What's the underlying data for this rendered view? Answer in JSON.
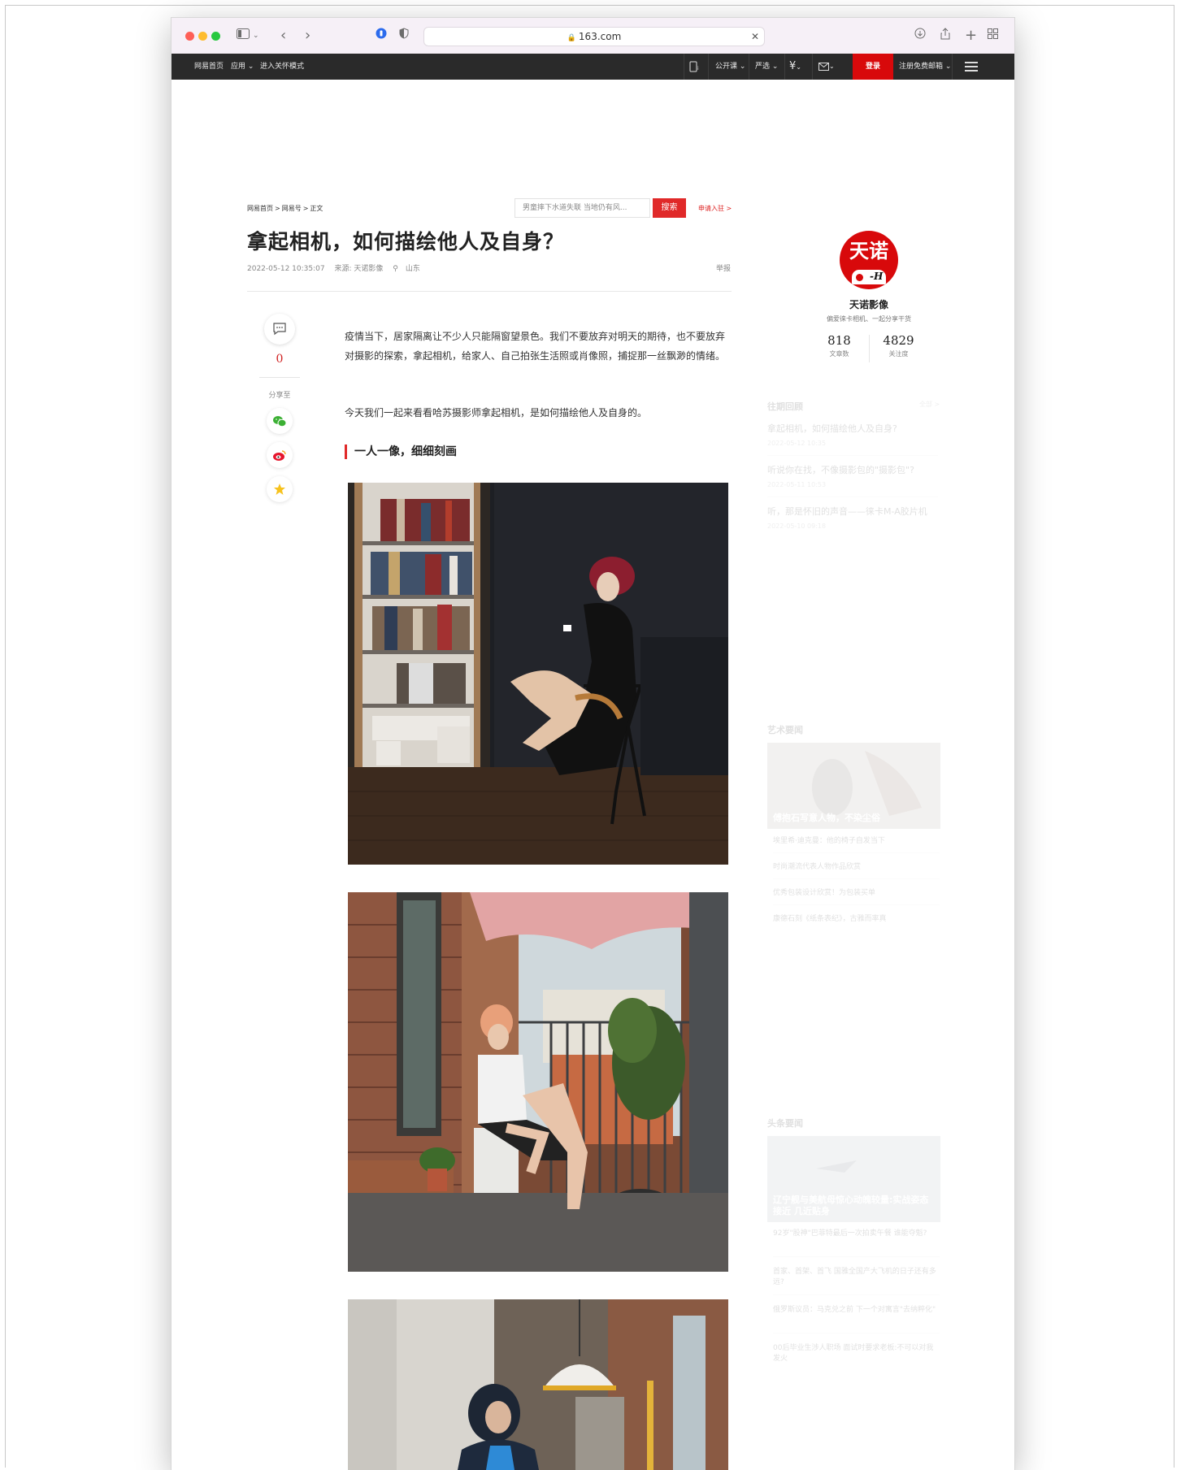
{
  "browser": {
    "url": "163.com"
  },
  "nav": {
    "home": "网易首页",
    "apps": "应用",
    "care_mode": "进入关怀模式",
    "open_course": "公开课",
    "yanxuan": "严选",
    "login": "登录",
    "free_mail": "注册免费邮箱"
  },
  "breadcrumb": {
    "home": "网易首页",
    "sep1": ">",
    "section": "网易号",
    "sep2": ">",
    "current": "正文"
  },
  "search": {
    "placeholder": "男童摔下水道失联 当地仍有风...",
    "button": "搜索",
    "apply": "申请入驻 >"
  },
  "article": {
    "title": "拿起相机，如何描绘他人及自身？",
    "date": "2022-05-12 10:35:07",
    "source": "来源: 天诺影像",
    "location": "山东",
    "report": "举报",
    "para1": "疫情当下，居家隔离让不少人只能隔窗望景色。我们不要放弃对明天的期待，也不要放弃对摄影的探索，拿起相机，给家人、自己拍张生活照或肖像照，捕捉那一丝飘渺的情绪。",
    "para2": "今天我们一起来看看哈苏摄影师拿起相机，是如何描绘他人及自身的。",
    "section_heading": "一人一像，细细刻画"
  },
  "side_actions": {
    "comment_count": "0",
    "share_label": "分享至"
  },
  "profile": {
    "logo_text": "天诺",
    "name": "天诺影像",
    "desc": "偏爱徕卡相机、一起分享干货",
    "articles_count": "818",
    "articles_label": "文章数",
    "followers_count": "4829",
    "followers_label": "关注度"
  },
  "past": {
    "title": "往期回顾",
    "more": "全部 >",
    "items": [
      {
        "title": "拿起相机，如何描绘他人及自身?",
        "date": "2022-05-12 10:35"
      },
      {
        "title": "听说你在找，不像摄影包的\"摄影包\"?",
        "date": "2022-05-11 10:53"
      },
      {
        "title": "听，那是怀旧的声音——徕卡M-A胶片机",
        "date": "2022-05-10 09:18"
      }
    ]
  },
  "art_news": {
    "title": "艺术要闻",
    "thumb_caption": "傅抱石写意人物，不染尘俗",
    "items": [
      "埃里希·迪克曼：他的椅子自发当下",
      "时尚潮流代表人物作品欣赏",
      "优秀包装设计欣赏！为包装买单",
      "康德石刻《纸条表纪》，古雅而率真"
    ]
  },
  "headlines": {
    "title": "头条要闻",
    "thumb_caption": "辽宁舰与美航母惊心动魄较量:实战姿态接近 几近贴身",
    "items": [
      "92岁\"股神\"巴菲特最后一次拍卖午餐 谁能夺魁?",
      "首家、首架、首飞 国雅全国产大飞机的日子还有多远?",
      "俄罗斯议员：马克兑之前 下一个对寓言\"去纳粹化\"",
      "00后毕业生涉人职场 面试时要求老板:不可以对我发火"
    ]
  },
  "colors": {
    "brand_red": "#d8090b",
    "nav_bg": "#2a2a2a",
    "accent_red": "#e02929"
  }
}
